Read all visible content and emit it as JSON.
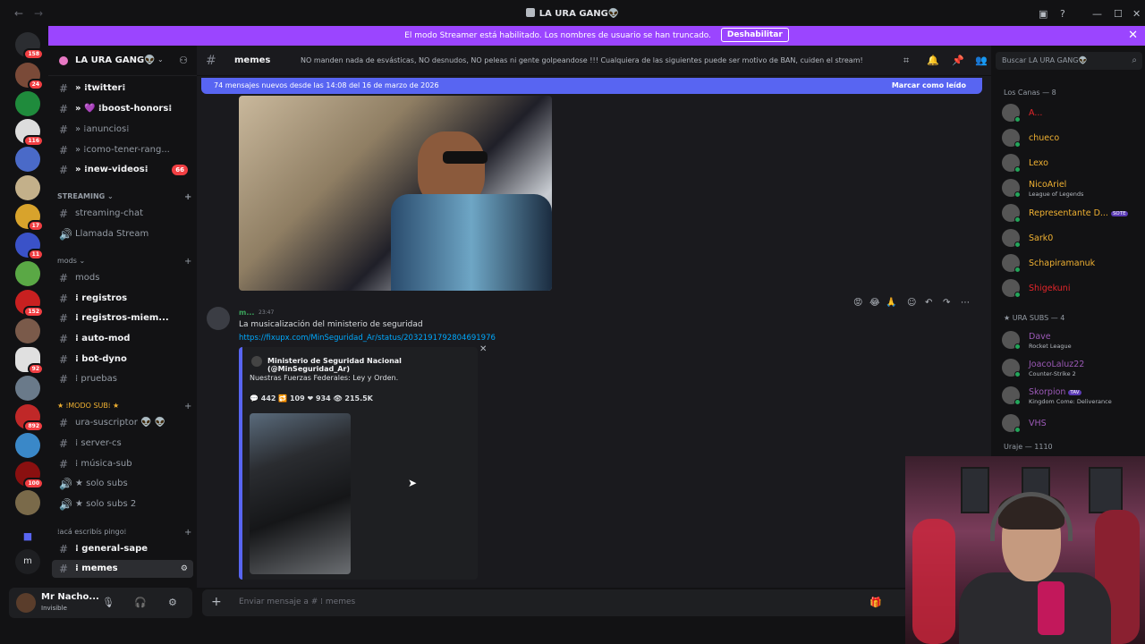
{
  "window": {
    "title": "LA URA GANG👽"
  },
  "banner": {
    "text": "El modo Streamer está habilitado. Los nombres de usuario se han truncado.",
    "button": "Deshabilitar"
  },
  "servers": [
    {
      "badge": "158"
    },
    {
      "badge": "24"
    },
    {
      "badge": ""
    },
    {
      "badge": "116"
    },
    {
      "badge": ""
    },
    {
      "badge": ""
    },
    {
      "badge": "17"
    },
    {
      "badge": "11"
    },
    {
      "badge": ""
    },
    {
      "badge": "152"
    },
    {
      "badge": ""
    },
    {
      "badge": "92"
    },
    {
      "badge": ""
    },
    {
      "badge": "892"
    },
    {
      "badge": ""
    },
    {
      "badge": "100"
    },
    {
      "badge": ""
    }
  ],
  "guild": {
    "name": "LA URA GANG👽"
  },
  "channels": {
    "top": [
      {
        "label": "» ⁞twitter⁞",
        "bold": true,
        "badge": ""
      },
      {
        "label": "» 💜 ⁞boost-honors⁞",
        "bold": true,
        "badge": ""
      },
      {
        "label": "» ⁞anuncios⁞",
        "bold": false,
        "badge": ""
      },
      {
        "label": "» ⁞como-tener-rang...",
        "bold": false,
        "badge": ""
      },
      {
        "label": "» ⁞new-videos⁞",
        "bold": true,
        "badge": "66"
      }
    ],
    "streaming_category": "STREAMING",
    "streaming": [
      {
        "label": "streaming-chat"
      },
      {
        "label": "Llamada Stream"
      }
    ],
    "mods_category": "mods",
    "mods": [
      {
        "label": "mods",
        "bold": false
      },
      {
        "label": "⁞ registros",
        "bold": true
      },
      {
        "label": "⁞ registros-miem...",
        "bold": true
      },
      {
        "label": "⁞ auto-mod",
        "bold": true
      },
      {
        "label": "⁞ bot-dyno",
        "bold": true
      },
      {
        "label": "⁞ pruebas",
        "bold": false
      }
    ],
    "sub_category": "★ ⁞MODO SUB⁞ ★",
    "sub": [
      {
        "label": "ura-suscriptor 👽 👽"
      },
      {
        "label": "⁞ server-cs"
      },
      {
        "label": "⁞ música-sub"
      },
      {
        "label": "★ solo subs"
      },
      {
        "label": "★ solo subs 2"
      }
    ],
    "chat_category": "⁞acá escribís pingo⁞",
    "chat": [
      {
        "label": "⁞ general-sape",
        "bold": true
      },
      {
        "label": "⁞ memes",
        "bold": true,
        "active": true
      }
    ]
  },
  "user": {
    "name": "Mr Nacho...",
    "status": "Invisible"
  },
  "channel_header": {
    "name": "memes",
    "topic": "NO manden nada de esvásticas, NO desnudos, NO peleas ni gente golpeandose !!! Cualquiera de las siguientes puede ser motivo de BAN, cuiden el stream!"
  },
  "search": {
    "placeholder": "Buscar LA URA GANG👽"
  },
  "new_messages": {
    "text": "74 mensajes nuevos desde las 14:08 del 16 de marzo de 2026",
    "mark_read": "Marcar como leído"
  },
  "message": {
    "author": "m...",
    "time": "23:47",
    "text": "La musicalización del ministerio de seguridad",
    "link": "https://fixupx.com/MinSeguridad_Ar/status/2032191792804691976",
    "embed": {
      "author": "Ministerio de Seguridad Nacional (@MinSeguridad_Ar)",
      "description": "Nuestras Fuerzas Federales: Ley y Orden.",
      "stats": "💬 442  🔁 109  ❤ 934  👁 215.5K"
    }
  },
  "composer": {
    "placeholder": "Enviar mensaje a # ⁞ memes"
  },
  "members": {
    "group1": "Los Canas — 8",
    "group1_members": [
      {
        "name": "A...",
        "sub": "",
        "color": "#e5252a"
      },
      {
        "name": "chueco",
        "sub": "",
        "color": "#f0b132"
      },
      {
        "name": "Lexo",
        "sub": "",
        "color": "#f0b132"
      },
      {
        "name": "NicoAriel",
        "sub": "League of Legends",
        "color": "#f0b132"
      },
      {
        "name": "Representante D...",
        "sub": "",
        "color": "#f0b132",
        "tag": "SOTE"
      },
      {
        "name": "Sark0",
        "sub": "",
        "color": "#f0b132"
      },
      {
        "name": "Schapiramanuk",
        "sub": "",
        "color": "#f0b132"
      },
      {
        "name": "Shigekuni",
        "sub": "",
        "color": "#e5252a"
      }
    ],
    "group2": "URA SUBS — 4",
    "group2_members": [
      {
        "name": "Dave",
        "sub": "Rocket League",
        "color": "#9b59b6"
      },
      {
        "name": "JoacoLaluz22",
        "sub": "Counter-Strike 2",
        "color": "#9b59b6"
      },
      {
        "name": "Skorpion",
        "sub": "Kingdom Come: Deliverance",
        "color": "#9b59b6",
        "tag": "TAV"
      },
      {
        "name": "VHS",
        "sub": "",
        "color": "#9b59b6"
      }
    ],
    "group3": "Uraje — 1110"
  }
}
